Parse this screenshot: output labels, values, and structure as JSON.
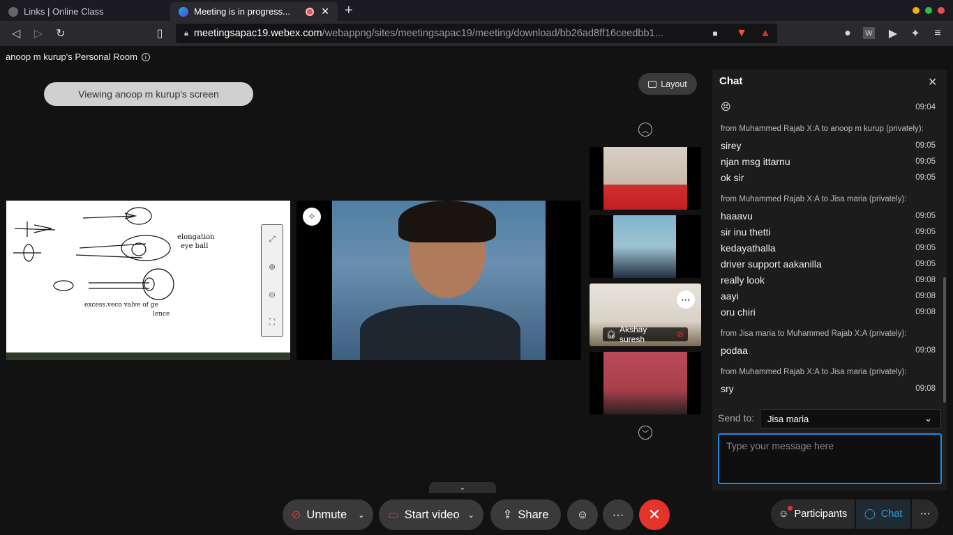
{
  "browser": {
    "tabs": [
      {
        "title": "Links | Online Class",
        "active": false
      },
      {
        "title": "Meeting is in progress...",
        "active": true
      }
    ],
    "url_domain": "meetingsapac19.webex.com",
    "url_path": "/webappng/sites/meetingsapac19/meeting/download/bb26ad8ff16ceedbb1..."
  },
  "meeting": {
    "room_name": "anoop m kurup's Personal Room",
    "viewing_banner": "Viewing anoop m kurup's screen",
    "layout_label": "Layout",
    "thumb_names": [
      "Akshay suresh"
    ]
  },
  "controls": {
    "unmute": "Unmute",
    "start_video": "Start video",
    "share": "Share"
  },
  "chat": {
    "title": "Chat",
    "groups": [
      {
        "from": "",
        "messages": [
          {
            "text": "😣",
            "time": "09:04"
          }
        ]
      },
      {
        "from": "from Muhammed Rajab X:A to anoop m kurup (privately):",
        "messages": [
          {
            "text": "sirey",
            "time": "09:05"
          },
          {
            "text": "njan msg ittarnu",
            "time": "09:05"
          },
          {
            "text": "ok sir",
            "time": "09:05"
          }
        ]
      },
      {
        "from": "from Muhammed Rajab X:A to Jisa maria (privately):",
        "messages": [
          {
            "text": "haaavu",
            "time": "09:05"
          },
          {
            "text": "sir inu thetti",
            "time": "09:05"
          },
          {
            "text": "kedayathalla",
            "time": "09:05"
          },
          {
            "text": "driver support aakanilla",
            "time": "09:05"
          },
          {
            "text": "really look",
            "time": "09:08"
          },
          {
            "text": "aayi",
            "time": "09:08"
          },
          {
            "text": "oru chiri",
            "time": "09:08"
          }
        ]
      },
      {
        "from": "from Jisa maria to Muhammed Rajab X:A (privately):",
        "messages": [
          {
            "text": "podaa",
            "time": "09:08"
          }
        ]
      },
      {
        "from": "from Muhammed Rajab X:A to Jisa maria (privately):",
        "messages": [
          {
            "text": "sry",
            "time": "09:08"
          }
        ]
      }
    ],
    "send_to_label": "Send to:",
    "send_to_value": "Jisa maria",
    "input_placeholder": "Type your message here"
  },
  "sidebar_buttons": {
    "participants": "Participants",
    "chat": "Chat"
  },
  "colors": {
    "accent": "#1e88e5",
    "end": "#e5322b",
    "chat_active": "#2d9cdb"
  }
}
